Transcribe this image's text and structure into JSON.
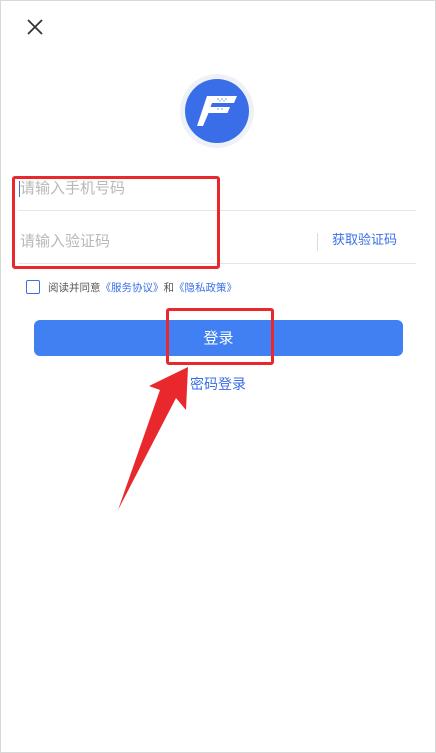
{
  "close": {
    "icon": "close-icon"
  },
  "logo": {
    "icon": "app-logo",
    "letter": "F",
    "color": "#3a6ee8"
  },
  "phone_field": {
    "placeholder": "请输入手机号码",
    "value": ""
  },
  "code_field": {
    "placeholder": "请输入验证码",
    "value": "",
    "get_code_label": "获取验证码"
  },
  "agreement": {
    "prefix": "阅读并同意",
    "service_link": "《服务协议》",
    "and": "和",
    "privacy_link": "《隐私政策》",
    "checked": false
  },
  "login_button": {
    "label": "登录"
  },
  "password_login": {
    "label": "密码登录"
  },
  "colors": {
    "accent": "#4080f2",
    "link": "#3a6ee8",
    "annotation": "#e8282c"
  }
}
